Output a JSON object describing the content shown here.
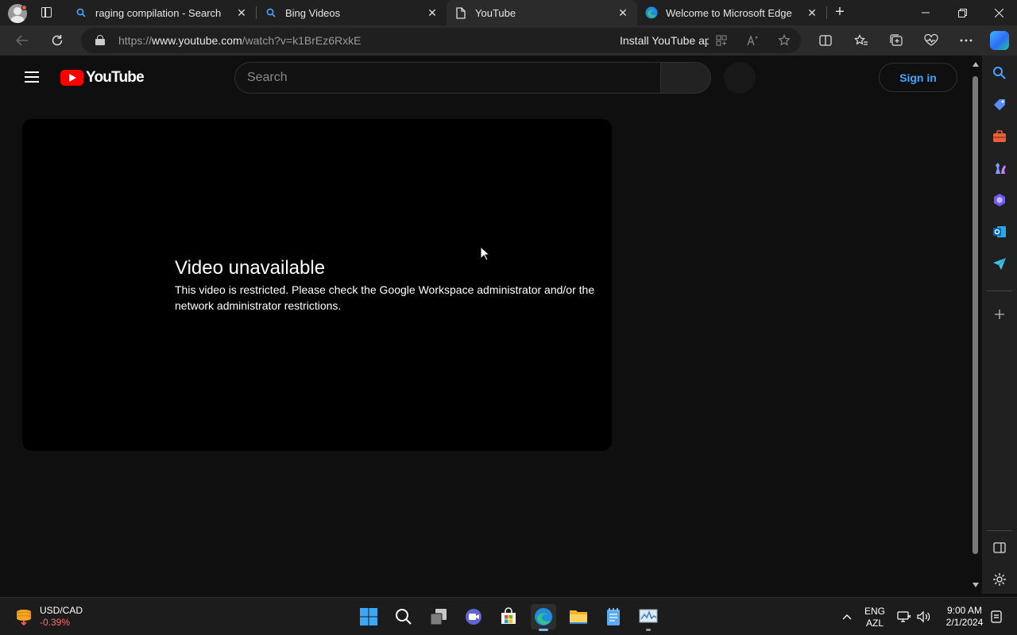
{
  "browser": {
    "tabs": [
      {
        "title": "raging compilation - Search",
        "icon": "search-icon",
        "active": false
      },
      {
        "title": "Bing Videos",
        "icon": "search-icon",
        "active": false
      },
      {
        "title": "YouTube",
        "icon": "page-icon",
        "active": true
      },
      {
        "title": "Welcome to Microsoft Edge",
        "icon": "edge-icon",
        "active": false
      }
    ],
    "address": {
      "prefix": "https://",
      "host": "www.youtube.com",
      "path": "/watch?v=k1BrEz6RxkE",
      "install_label": "Install YouTube ap"
    }
  },
  "youtube": {
    "logo_text": "YouTube",
    "search_placeholder": "Search",
    "sign_in_label": "Sign in",
    "error_title": "Video unavailable",
    "error_message": "This video is restricted. Please check the Google Workspace administrator and/or the network administrator restrictions."
  },
  "taskbar": {
    "ticker_symbol": "USD/CAD",
    "ticker_change": "-0.39%",
    "lang_top": "ENG",
    "lang_bottom": "AZL",
    "time": "9:00 AM",
    "date": "2/1/2024"
  },
  "colors": {
    "youtube_red": "#ff0000",
    "signin_blue": "#3ea6ff",
    "ticker_negative": "#ff6b6b",
    "page_bg": "#0f0f0f"
  }
}
